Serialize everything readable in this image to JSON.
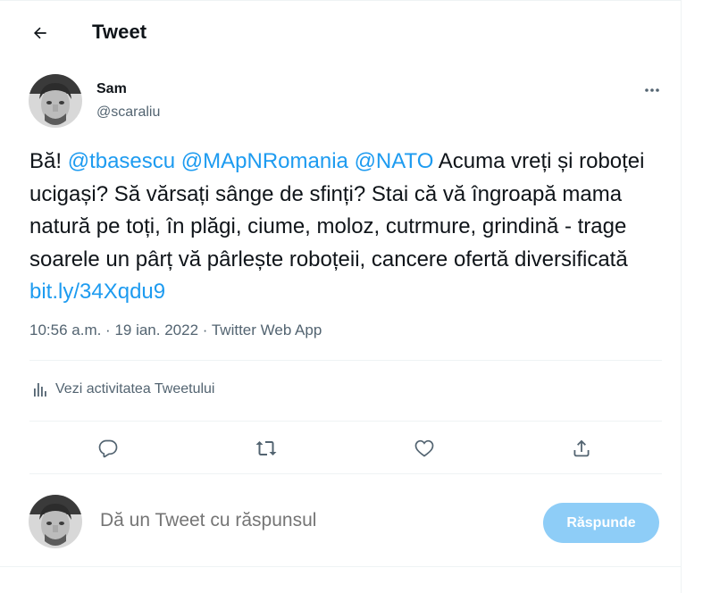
{
  "header": {
    "title": "Tweet",
    "back_icon": "arrow-left-icon"
  },
  "author": {
    "name": "Sam",
    "handle": "@scaraliu",
    "avatar_icon": "user-avatar"
  },
  "tweet": {
    "segments": [
      {
        "text": "Bă! ",
        "type": "text"
      },
      {
        "text": "@tbasescu",
        "type": "link"
      },
      {
        "text": " ",
        "type": "text"
      },
      {
        "text": "@MApNRomania",
        "type": "link"
      },
      {
        "text": " ",
        "type": "text"
      },
      {
        "text": "@NATO",
        "type": "link"
      },
      {
        "text": "  Acuma vreți și roboței ucigași? Să vărsați sânge de sfinți? Stai că vă îngroapă mama natură pe toți, în plăgi, ciume, moloz, cutrmure, grindină - trage soarele un pârț vă pârlește roboțeii, cancere ofertă diversificată ",
        "type": "text"
      },
      {
        "text": "bit.ly/34Xqdu9",
        "type": "link"
      }
    ],
    "time": "10:56 a.m.",
    "separator": " · ",
    "date": "19 ian. 2022",
    "app": "Twitter Web App"
  },
  "activity": {
    "label": "Vezi activitatea Tweetului",
    "icon": "bar-chart-icon"
  },
  "actions": [
    {
      "name": "reply-action",
      "icon": "comment-icon"
    },
    {
      "name": "retweet-action",
      "icon": "retweet-icon"
    },
    {
      "name": "like-action",
      "icon": "heart-icon"
    },
    {
      "name": "share-action",
      "icon": "share-icon"
    }
  ],
  "reply": {
    "placeholder": "Dă un Tweet cu răspunsul",
    "button_label": "Răspunde"
  },
  "colors": {
    "link": "#1d9bf0",
    "muted": "#536471",
    "button": "#8ecdf7",
    "divider": "#eff3f4"
  }
}
